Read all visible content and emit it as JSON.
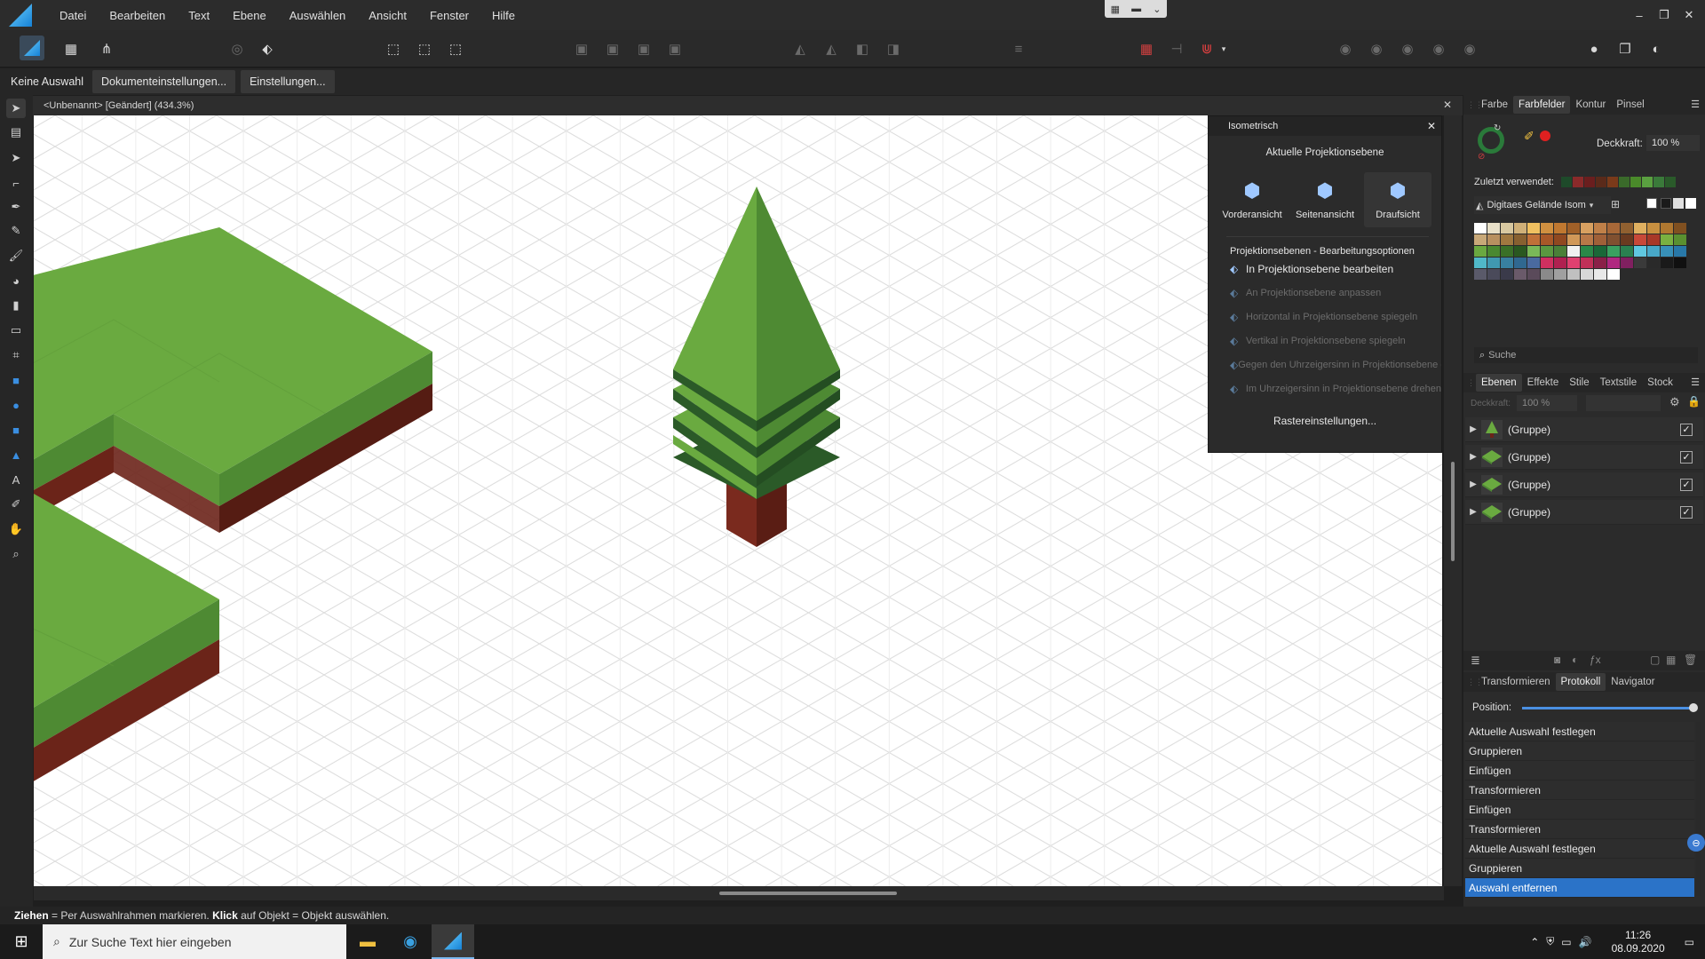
{
  "window": {
    "controls": [
      "–",
      "❐",
      "✕"
    ]
  },
  "menu": {
    "items": [
      "Datei",
      "Bearbeiten",
      "Text",
      "Ebene",
      "Auswählen",
      "Ansicht",
      "Fenster",
      "Hilfe"
    ]
  },
  "context": {
    "selection_label": "Keine Auswahl",
    "doc_settings": "Dokumenteinstellungen...",
    "settings": "Einstellungen..."
  },
  "document": {
    "title": "<Unbenannt> [Geändert] (434.3%)"
  },
  "iso_panel": {
    "title": "Isometrisch",
    "current_plane": "Aktuelle Projektionsebene",
    "views": [
      "Vorderansicht",
      "Seitenansicht",
      "Draufsicht"
    ],
    "active_view": "Draufsicht",
    "options_title": "Projektionsebenen - Bearbeitungsoptionen",
    "options": [
      "In Projektionsebene bearbeiten",
      "An Projektionsebene anpassen",
      "Horizontal in Projektionsebene spiegeln",
      "Vertikal in Projektionsebene spiegeln",
      "Gegen den Uhrzeigersinn in Projektionsebene drehen",
      "Im Uhrzeigersinn in Projektionsebene drehen"
    ],
    "raster_button": "Rastereinstellungen..."
  },
  "color_panel": {
    "tabs": [
      "Farbe",
      "Farbfelder",
      "Kontur",
      "Pinsel"
    ],
    "active_tab": "Farbfelder",
    "opacity_label": "Deckkraft:",
    "opacity_value": "100 %",
    "recent_label": "Zuletzt verwendet:",
    "palette_name": "Digitaes Gelände Isom",
    "search_placeholder": "Suche",
    "recent_colors": [
      "#1e4a2a",
      "#8a2a2a",
      "#6a1e1e",
      "#5a2a1a",
      "#7a3a1a",
      "#3a6a2a",
      "#4a8a2a",
      "#5aa040",
      "#3a7a3a",
      "#2a5a2a"
    ],
    "swatches": [
      [
        "#ffffff",
        "#e8e0c8",
        "#d8c8a0",
        "#d0b078",
        "#f0c060",
        "#d09040",
        "#c07830",
        "#a06028",
        "#d8a060",
        "#c08048",
        "#a86838",
        "#906030",
        "#e0b060",
        "#c89040",
        "#b07830",
        "#805020"
      ],
      [
        "#c8a878",
        "#b89060",
        "#a07840",
        "#886030",
        "#c07038",
        "#a85828",
        "#904820",
        "#d09858",
        "#b87848",
        "#a06038",
        "#805030",
        "#6a3a20",
        "#c84838",
        "#a83828",
        "#7ab040",
        "#5a9030"
      ],
      [
        "#6aa840",
        "#4a8830",
        "#3a7028",
        "#2a5820",
        "#7ab858",
        "#5a9840",
        "#4a8038",
        "#f0f0f0",
        "#2a8848",
        "#1a6838",
        "#3aa060",
        "#2a8050",
        "#60c8e0",
        "#48a8c8",
        "#3890b8",
        "#2878a8"
      ],
      [
        "#50b8c8",
        "#4098b0",
        "#3880a0",
        "#306890",
        "#4a6aa0",
        "#d03060",
        "#b02050",
        "#e04070",
        "#c03058",
        "#8a2048",
        "#b02880",
        "#802060",
        "#3a3a3a",
        "#2a2a2a",
        "#1a1a1a",
        "#101010"
      ],
      [
        "#5a5a6a",
        "#4a4a5a",
        "#3a3a4a",
        "#6a5a6a",
        "#5a4a5a",
        "#8a8a8a",
        "#a0a0a0",
        "#c0c0c0",
        "#d8d8d8",
        "#e8e8e8",
        "#ffffff"
      ]
    ]
  },
  "layers_panel": {
    "tabs": [
      "Ebenen",
      "Effekte",
      "Stile",
      "Textstile",
      "Stock"
    ],
    "active_tab": "Ebenen",
    "opacity_label": "Deckkraft:",
    "opacity_value": "100 %",
    "layers": [
      {
        "name": "(Gruppe)",
        "thumb": "tree",
        "visible": true
      },
      {
        "name": "(Gruppe)",
        "thumb": "tile",
        "visible": true
      },
      {
        "name": "(Gruppe)",
        "thumb": "tile",
        "visible": true
      },
      {
        "name": "(Gruppe)",
        "thumb": "tile",
        "visible": true
      }
    ]
  },
  "history_panel": {
    "tabs": [
      "Transformieren",
      "Protokoll",
      "Navigator"
    ],
    "active_tab": "Protokoll",
    "position_label": "Position:",
    "position_fraction": 1.0,
    "entries": [
      "Aktuelle Auswahl festlegen",
      "Gruppieren",
      "Einfügen",
      "Transformieren",
      "Einfügen",
      "Transformieren",
      "Aktuelle Auswahl festlegen",
      "Gruppieren",
      "Auswahl entfernen"
    ],
    "selected": "Auswahl entfernen"
  },
  "status": {
    "hint_bold1": "Ziehen",
    "hint1": " = Per Auswahlrahmen markieren. ",
    "hint_bold2": "Klick",
    "hint2": " auf Objekt = Objekt auswählen."
  },
  "taskbar": {
    "search_placeholder": "Zur Suche Text hier eingeben",
    "time": "11:26",
    "date": "08.09.2020"
  },
  "colors": {
    "grass_top": "#6aaa40",
    "grass_side": "#4e8a33",
    "grass_dark": "#2e5a28",
    "soil": "#6b2419",
    "soil_dark": "#501a12",
    "accent": "#2b73c8"
  }
}
